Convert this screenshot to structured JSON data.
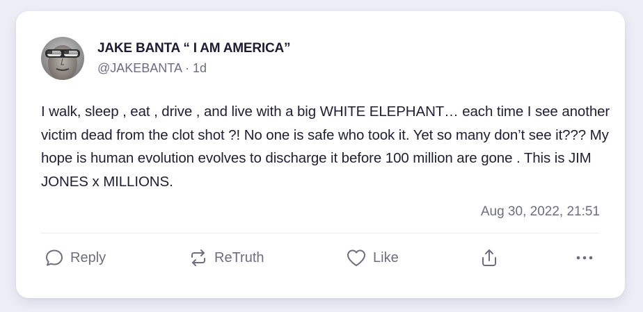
{
  "post": {
    "display_name": "JAKE BANTA “ I AM AMERICA”",
    "handle": "@JAKEBANTA",
    "separator": " · ",
    "age": "1d",
    "body": "I walk, sleep , eat , drive , and live with a big WHITE ELEPHANT… each time I see another victim dead from the clot shot ?! No one is safe who took it. Yet so many don’t see it??? My hope is human evolution evolves to discharge it before 100 million are gone . This is JIM JONES x MILLIONS.",
    "timestamp": "Aug 30, 2022, 21:51"
  },
  "actions": {
    "reply_label": "Reply",
    "retruth_label": "ReTruth",
    "like_label": "Like"
  },
  "colors": {
    "background": "#eeeef6",
    "card": "#ffffff",
    "text_primary": "#1c1b33",
    "text_secondary": "#6d6c80"
  },
  "icons": {
    "reply": "speech-bubble-icon",
    "retruth": "repost-arrows-icon",
    "like": "heart-icon",
    "share": "share-upload-icon",
    "more": "ellipsis-icon"
  }
}
